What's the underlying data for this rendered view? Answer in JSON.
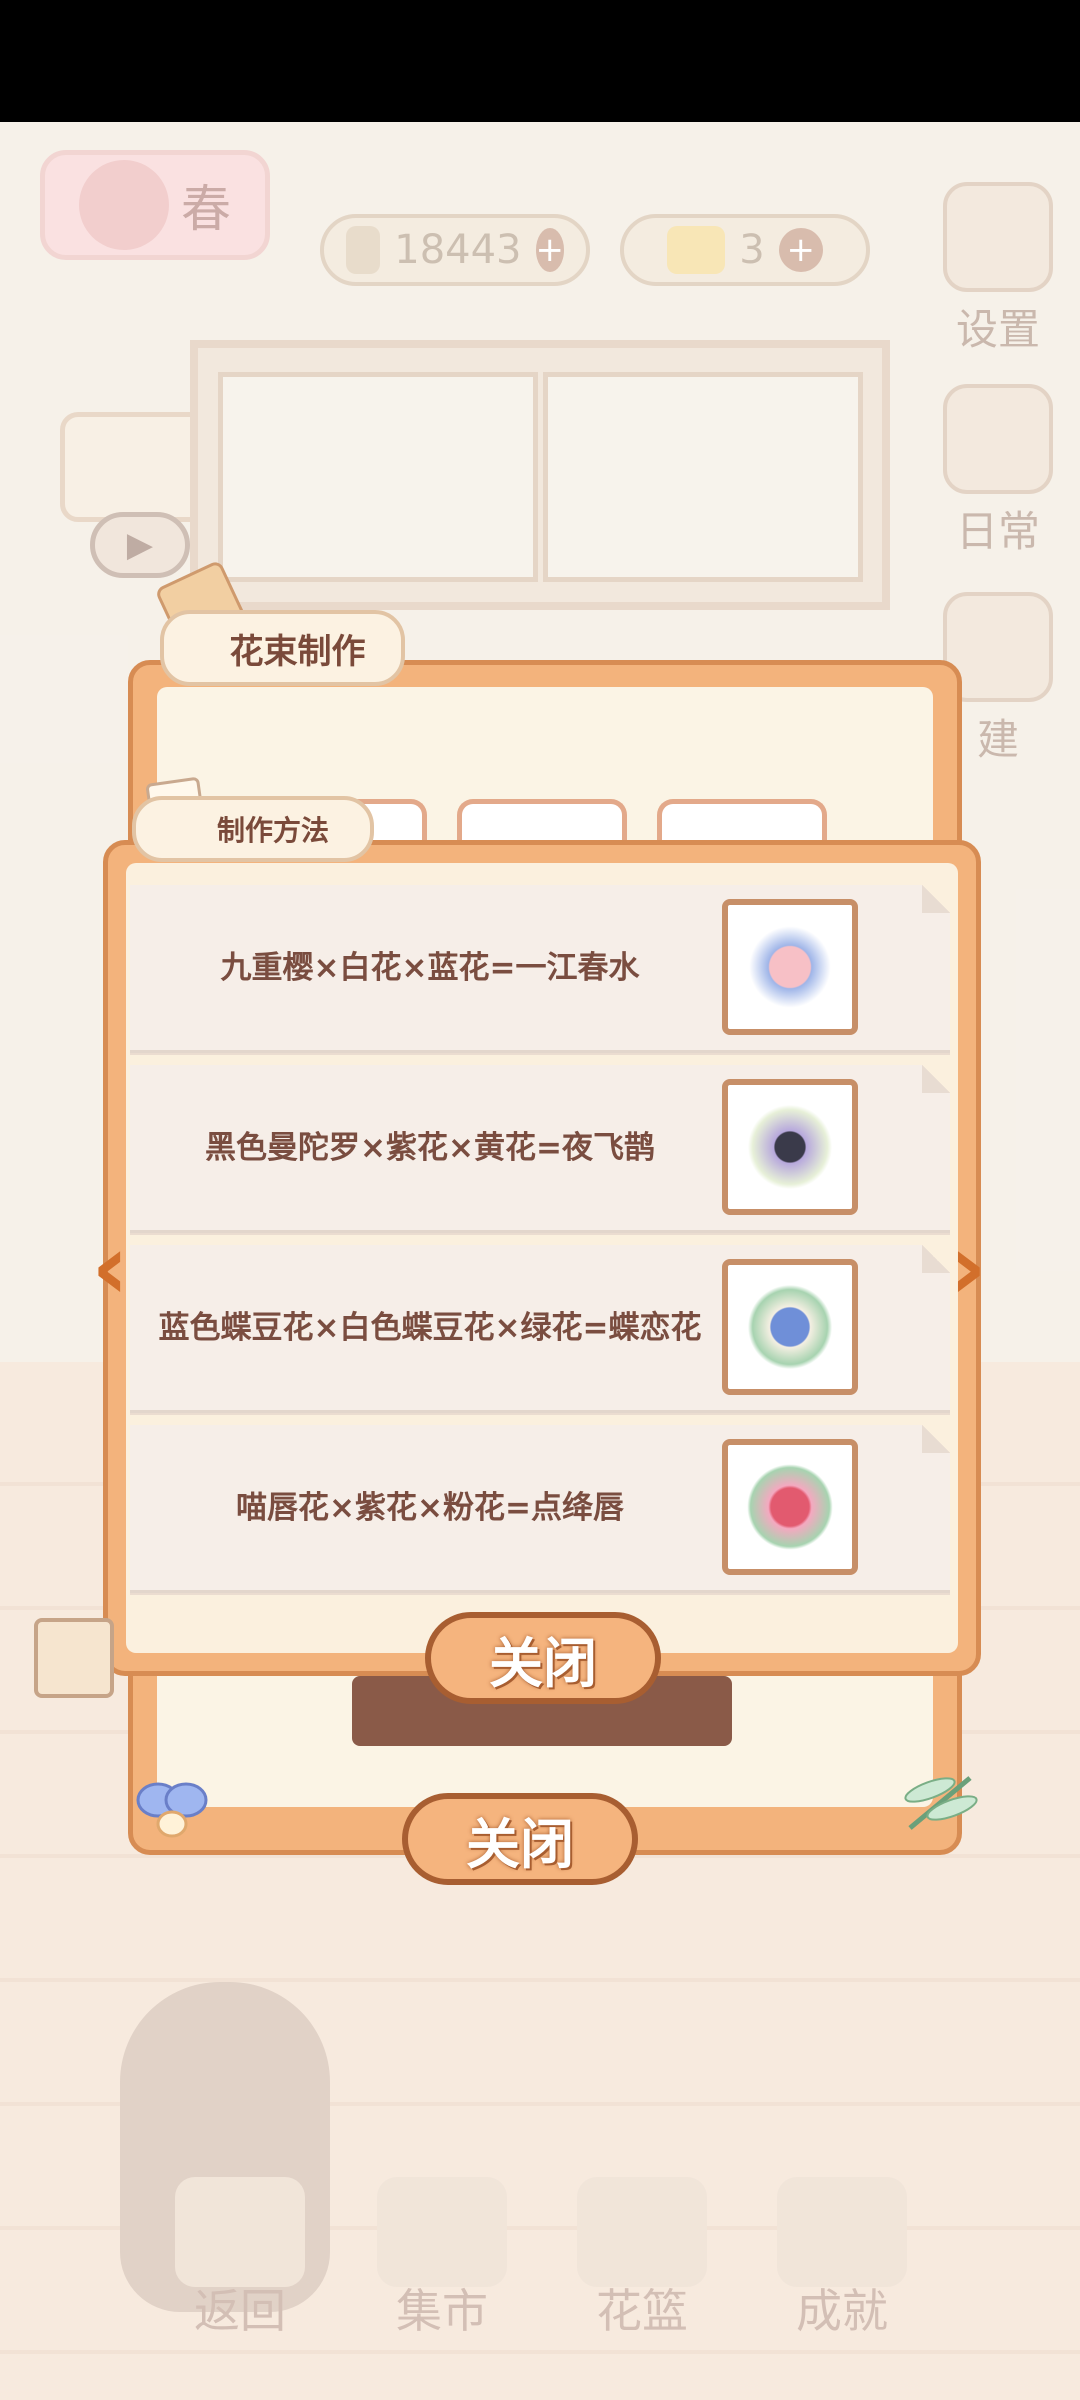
{
  "hud": {
    "season": "春",
    "fish_count": "18443",
    "cheese_count": "3",
    "plus": "+"
  },
  "side_buttons": {
    "settings": "设置",
    "daily": "日常",
    "build": "建"
  },
  "bottom_nav": {
    "back": "返回",
    "market": "集市",
    "basket": "花篮",
    "achievement": "成就"
  },
  "bouquet_modal": {
    "title": "花束制作",
    "close_label": "关闭"
  },
  "method_modal": {
    "title": "制作方法",
    "close_label": "关闭",
    "recipes": [
      {
        "text": "九重樱×白花×蓝花=一江春水",
        "thumb_color": "#f0a8b0"
      },
      {
        "text": "黑色曼陀罗×紫花×黄花=夜飞鹊",
        "thumb_color": "#7b6aa8"
      },
      {
        "text": "蓝色蝶豆花×白色蝶豆花×绿花=蝶恋花",
        "thumb_color": "#7a9ad6"
      },
      {
        "text": "喵唇花×紫花×粉花=点绛唇",
        "thumb_color": "#e57c92"
      }
    ]
  },
  "arrows": {
    "left": "‹",
    "right": "›"
  },
  "icons": {
    "prev": "chevron-left-icon",
    "next": "chevron-right-icon",
    "settings": "gear-icon",
    "play": "play-icon"
  }
}
